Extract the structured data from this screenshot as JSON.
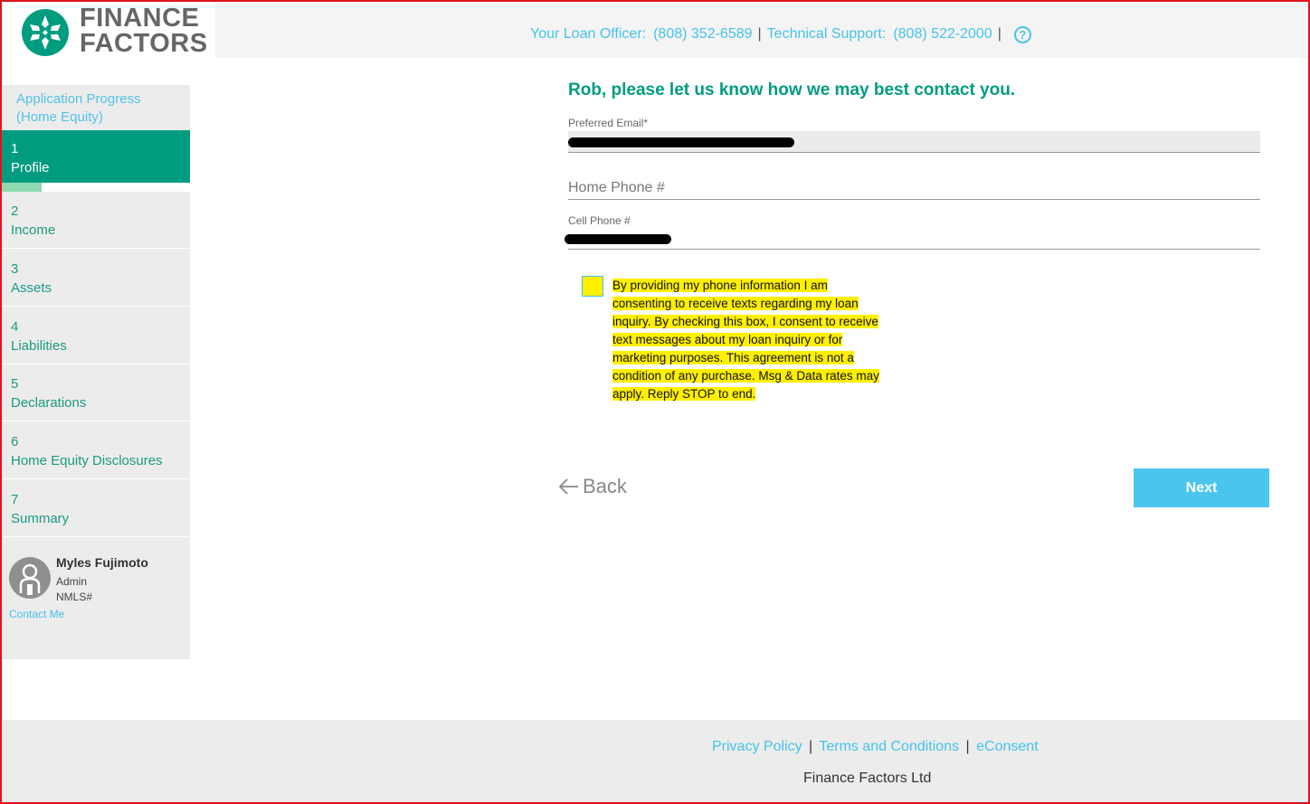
{
  "header": {
    "logo_line1": "FINANCE",
    "logo_line2": "FACTORS",
    "loan_officer_label": "Your Loan Officer:",
    "loan_officer_phone": "(808) 352-6589",
    "tech_support_label": "Technical Support:",
    "tech_support_phone": "(808) 522-2000",
    "separator": "|",
    "help_icon": "?"
  },
  "sidebar": {
    "title_line1": "Application Progress",
    "title_line2": "(Home Equity)",
    "progress_fraction": 0.21,
    "steps": [
      {
        "number": "1",
        "label": "Profile"
      },
      {
        "number": "2",
        "label": "Income"
      },
      {
        "number": "3",
        "label": "Assets"
      },
      {
        "number": "4",
        "label": "Liabilities"
      },
      {
        "number": "5",
        "label": "Declarations"
      },
      {
        "number": "6",
        "label": "Home Equity Disclosures"
      },
      {
        "number": "7",
        "label": "Summary"
      }
    ],
    "officer": {
      "name": "Myles Fujimoto",
      "role": "Admin",
      "nmls": "NMLS#",
      "contact": "Contact Me"
    }
  },
  "form": {
    "title": "Rob, please let us know how we may best contact you.",
    "email_label": "Preferred Email*",
    "home_phone_placeholder": "Home Phone #",
    "cell_label": "Cell Phone #",
    "consent_lines": [
      "By providing my phone information I am",
      "consenting to receive texts regarding my loan",
      "inquiry. By checking this box, I consent to receive",
      "text messages about my loan inquiry or for",
      "marketing purposes. This agreement is not a",
      "condition of any purchase. Msg & Data rates may",
      "apply. Reply STOP to end."
    ],
    "back_label": "Back",
    "next_label": "Next"
  },
  "footer": {
    "privacy": "Privacy Policy",
    "terms": "Terms and Conditions",
    "econsent": "eConsent",
    "separator": "|",
    "company": "Finance Factors Ltd"
  },
  "colors": {
    "brand_green": "#009c80",
    "link_blue": "#45c3ea",
    "highlight": "#ffef00",
    "frame_red": "#e0141e"
  }
}
